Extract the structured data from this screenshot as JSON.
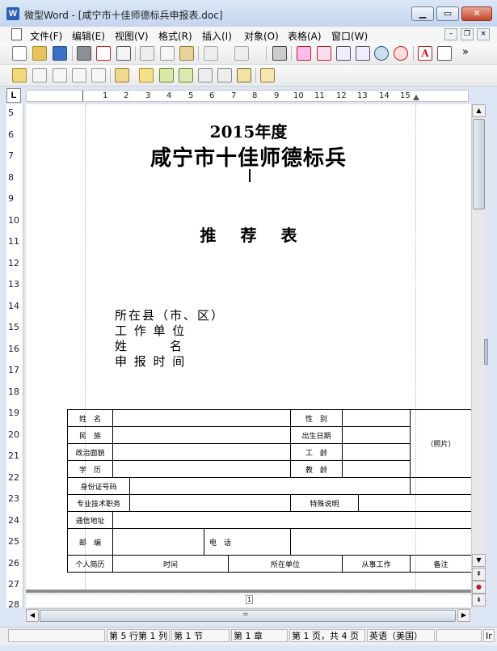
{
  "window": {
    "title": "微型Word - [咸宁市十佳师德标兵申报表.doc]",
    "app_icon": "W",
    "minimize": "▁",
    "maximize": "▭",
    "close": "✕"
  },
  "menu": {
    "items": [
      "文件(F)",
      "编辑(E)",
      "视图(V)",
      "格式(R)",
      "插入(I)",
      "对象(O)",
      "表格(A)",
      "窗口(W)"
    ],
    "mdi_min": "–",
    "mdi_restore": "❐",
    "mdi_close": "×"
  },
  "toolbar1_icons": [
    "new-doc-icon",
    "open-folder-icon",
    "save-icon",
    "print-icon",
    "pdf-icon",
    "print-preview-icon",
    "cut-icon",
    "copy-icon",
    "paste-icon",
    "undo-icon",
    "redo-icon",
    "find-icon",
    "one-to-one-icon",
    "page-width-icon",
    "page-view-icon",
    "two-page-icon",
    "zoom-icon",
    "percent-zoom-icon",
    "font-icon",
    "paragraph-icon"
  ],
  "toolbar1_more": "»",
  "toolbar2_icons": [
    "highlight-icon",
    "edit-comment-icon",
    "delete-comment-icon",
    "link-icon",
    "note-icon",
    "clipboard-icon",
    "star-pen-icon",
    "pen-check-icon",
    "pen-icon",
    "pencil-icon",
    "eraser-pen-icon",
    "notepad-icon",
    "track-changes-icon"
  ],
  "ruler": {
    "corner": "L",
    "h_ticks": [
      "1",
      "2",
      "3",
      "4",
      "5",
      "6",
      "7",
      "8",
      "9",
      "10",
      "11",
      "12",
      "13",
      "14",
      "15"
    ],
    "v_ticks": [
      "5",
      "6",
      "7",
      "8",
      "9",
      "10",
      "11",
      "12",
      "13",
      "14",
      "15",
      "16",
      "17",
      "18",
      "19",
      "20",
      "21",
      "22",
      "23",
      "24",
      "25",
      "26",
      "27",
      "28"
    ]
  },
  "doc": {
    "year_title": "2015年度",
    "main_title": "咸宁市十佳师德标兵",
    "subtitle": "推荐表",
    "info_lines": [
      "所在县（市、区）",
      "工 作 单 位",
      "姓　　　名",
      "申 报 时 间"
    ],
    "table": {
      "name": "姓　名",
      "gender": "性　别",
      "ethnicity": "民　族",
      "birth": "出生日期",
      "photo": "（照片）",
      "politics": "政治面貌",
      "work_age": "工　龄",
      "education": "学　历",
      "teach_age": "教　龄",
      "id_number": "身份证号码",
      "title": "专业技术职务",
      "remark_special": "特殊说明",
      "address": "通信地址",
      "postcode": "邮　编",
      "phone": "电　话",
      "resume": "个人简历",
      "time": "时间",
      "unit": "所在单位",
      "job": "从事工作",
      "notes": "备注"
    },
    "page2_number": "1"
  },
  "scroll": {
    "up": "▲",
    "down": "▼",
    "prev_page": "⇞",
    "next_page": "⇟",
    "browse": "●",
    "h_left": "◀",
    "h_right": "▶",
    "splitter": "="
  },
  "status": {
    "line_col": "第 5 行第 1 列",
    "section": "第 1 节",
    "chapter": "第 1 章",
    "pages": "第 1 页，共 4 页",
    "language": "英语（美国）",
    "ins": "Ir"
  }
}
